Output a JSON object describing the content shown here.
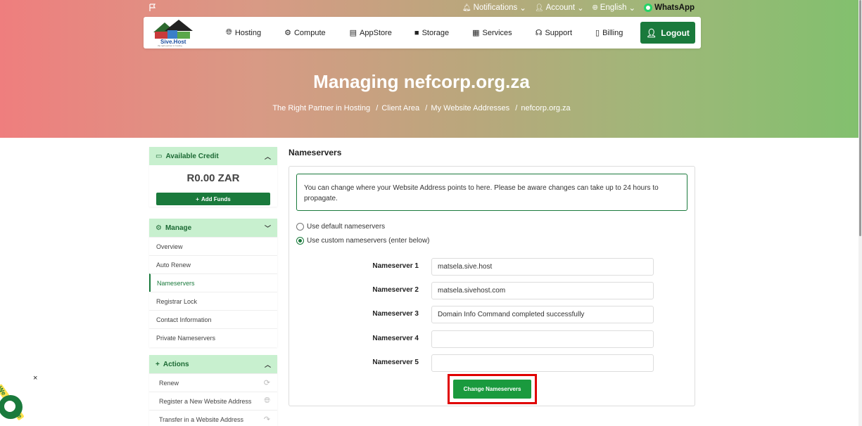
{
  "topbar": {
    "notifications": "Notifications",
    "account": "Account",
    "language": "English",
    "whatsapp": "WhatsApp"
  },
  "logo": {
    "name": "Sive.Host",
    "tagline": "the right partner in hosting"
  },
  "nav": {
    "items": [
      {
        "label": "Hosting",
        "icon": "globe-icon"
      },
      {
        "label": "Compute",
        "icon": "cog-icon"
      },
      {
        "label": "AppStore",
        "icon": "database-icon"
      },
      {
        "label": "Storage",
        "icon": "box-icon"
      },
      {
        "label": "Services",
        "icon": "gift-icon"
      },
      {
        "label": "Support",
        "icon": "headset-icon"
      },
      {
        "label": "Billing",
        "icon": "document-icon"
      }
    ],
    "logout": "Logout"
  },
  "header": {
    "title": "Managing nefcorp.org.za",
    "breadcrumb": [
      "The Right Partner in Hosting",
      "Client Area",
      "My Website Addresses",
      "nefcorp.org.za"
    ]
  },
  "sidebar": {
    "credit": {
      "title": "Available Credit",
      "amount": "R0.00 ZAR",
      "add_funds": "Add Funds"
    },
    "manage": {
      "title": "Manage",
      "items": [
        "Overview",
        "Auto Renew",
        "Nameservers",
        "Registrar Lock",
        "Contact Information",
        "Private Nameservers"
      ]
    },
    "actions": {
      "title": "Actions",
      "items": [
        "Renew",
        "Register a New Website Address",
        "Transfer in a Website Address"
      ]
    }
  },
  "main": {
    "title": "Nameservers",
    "info": "You can change where your Website Address points to here. Please be aware changes can take up to 24 hours to propagate.",
    "radio_default": "Use default nameservers",
    "radio_custom": "Use custom nameservers (enter below)",
    "nameservers": [
      {
        "label": "Nameserver 1",
        "value": "matsela.sive.host"
      },
      {
        "label": "Nameserver 2",
        "value": "matsela.sivehost.com"
      },
      {
        "label": "Nameserver 3",
        "value": "Domain Info Command completed successfully"
      },
      {
        "label": "Nameserver 4",
        "value": ""
      },
      {
        "label": "Nameserver 5",
        "value": ""
      }
    ],
    "submit": "Change Nameservers"
  },
  "chat": {
    "tag": "We Are Here",
    "close": "×"
  },
  "colors": {
    "accent": "#1a7a3c",
    "highlight": "#e00000",
    "panel_head": "#c8f0cf"
  }
}
